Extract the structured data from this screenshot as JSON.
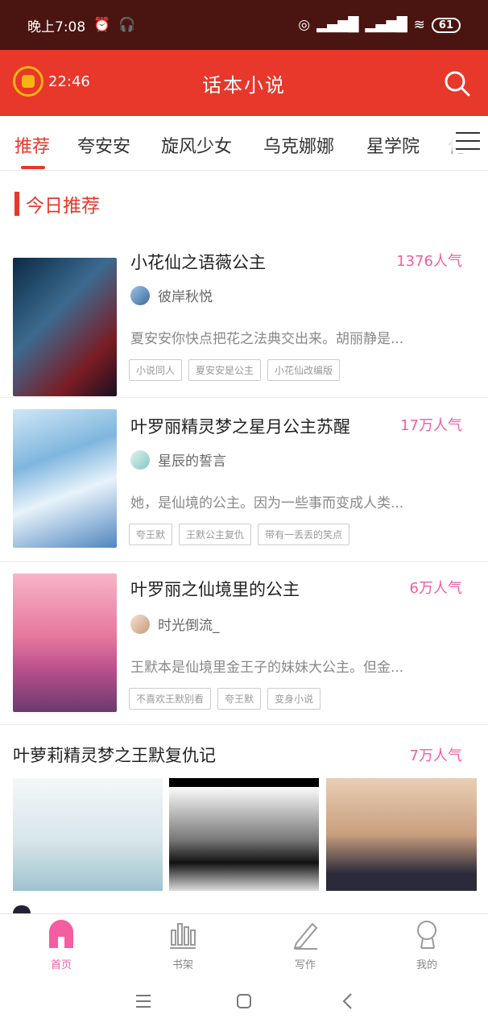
{
  "status_bar": {
    "time": "晚上7:08",
    "battery": "61"
  },
  "header": {
    "coin_time": "22:46",
    "title": "话本小说"
  },
  "tabs": [
    "推荐",
    "夸安安",
    "旋风少女",
    "乌克娜娜",
    "星学院",
    "化"
  ],
  "section": {
    "title": "今日推荐"
  },
  "books": [
    {
      "title": "小花仙之语薇公主",
      "popularity": "1376人气",
      "author": "彼岸秋悦",
      "desc": "夏安安你快点把花之法典交出来。胡丽静是...",
      "tags": [
        "小说同人",
        "夏安安是公主",
        "小花仙改编版"
      ]
    },
    {
      "title": "叶罗丽精灵梦之星月公主苏醒",
      "popularity": "17万人气",
      "author": "星辰的誓言",
      "desc": "她，是仙境的公主。因为一些事而变成人类...",
      "tags": [
        "夸王默",
        "王默公主复仇",
        "带有一丢丢的笑点"
      ]
    },
    {
      "title": "叶罗丽之仙境里的公主",
      "popularity": "6万人气",
      "author": "时光倒流_",
      "desc": "王默本是仙境里金王子的妹妹大公主。但金...",
      "tags": [
        "不喜欢王默别看",
        "夸王默",
        "变身小说"
      ]
    }
  ],
  "featured": {
    "title": "叶萝莉精灵梦之王默复仇记",
    "popularity": "7万人气"
  },
  "bottom_nav": [
    "首页",
    "书架",
    "写作",
    "我的"
  ],
  "colors": {
    "accent": "#e8372b",
    "pink": "#f45da0",
    "status_bg": "#4a1410"
  }
}
